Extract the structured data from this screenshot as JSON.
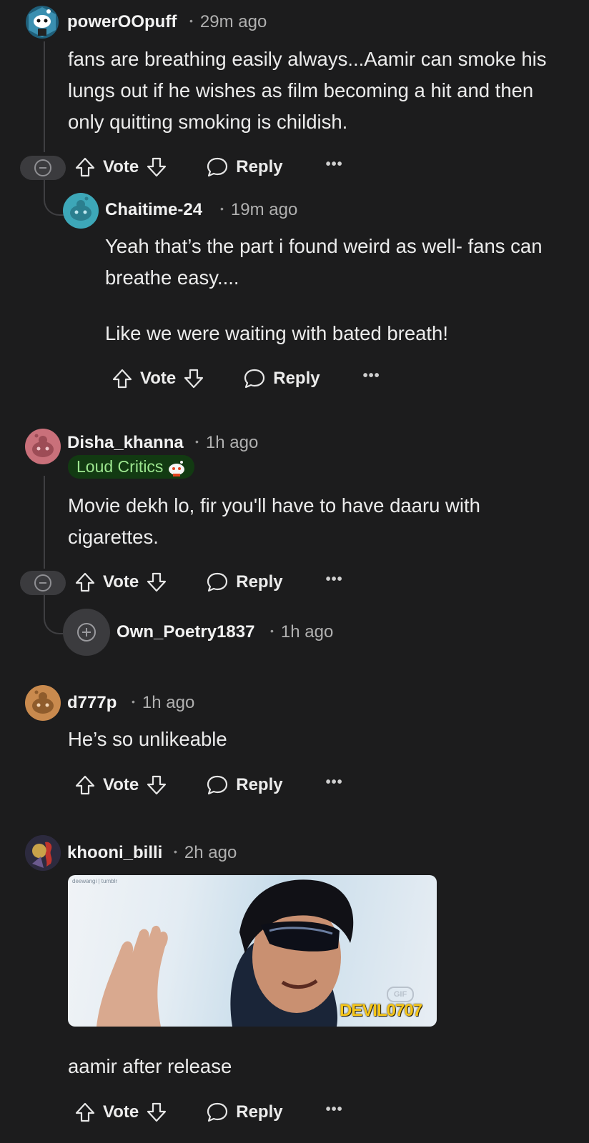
{
  "comments": [
    {
      "username": "powerOOpuff",
      "time": "29m ago",
      "body": [
        "fans are breathing easily always...Aamir can smoke his lungs out if he wishes as film becoming a hit and then only quitting smoking is childish."
      ],
      "avatar_color": "#3a8fb0"
    },
    {
      "username": "Chaitime-24",
      "time": "19m ago",
      "body": [
        "Yeah that’s the part i found weird as well- fans can breathe easy....",
        "Like we were waiting with bated breath!"
      ],
      "avatar_color": "#3da7b8"
    },
    {
      "username": "Disha_khanna",
      "time": "1h ago",
      "flair": "Loud Critics",
      "body": [
        "Movie dekh lo, fir you'll have to have daaru with cigarettes."
      ],
      "avatar_color": "#c9707a"
    },
    {
      "username": "Own_Poetry1837",
      "time": "1h ago"
    },
    {
      "username": "d777p",
      "time": "1h ago",
      "body": [
        "He’s so unlikeable"
      ],
      "avatar_color": "#c98a4e"
    },
    {
      "username": "khooni_billi",
      "time": "2h ago",
      "gif_watermark": "deewangi | tumblr",
      "gif_badge": "GIF",
      "gif_credit": "DEVIL0707",
      "body": [
        "aamir after release"
      ]
    }
  ],
  "actions": {
    "vote": "Vote",
    "reply": "Reply",
    "more": "•••"
  },
  "colors": {
    "background": "#1c1c1d",
    "flair_bg": "#123a12",
    "flair_text": "#9ce68f",
    "gif_credit": "#f5c518"
  }
}
